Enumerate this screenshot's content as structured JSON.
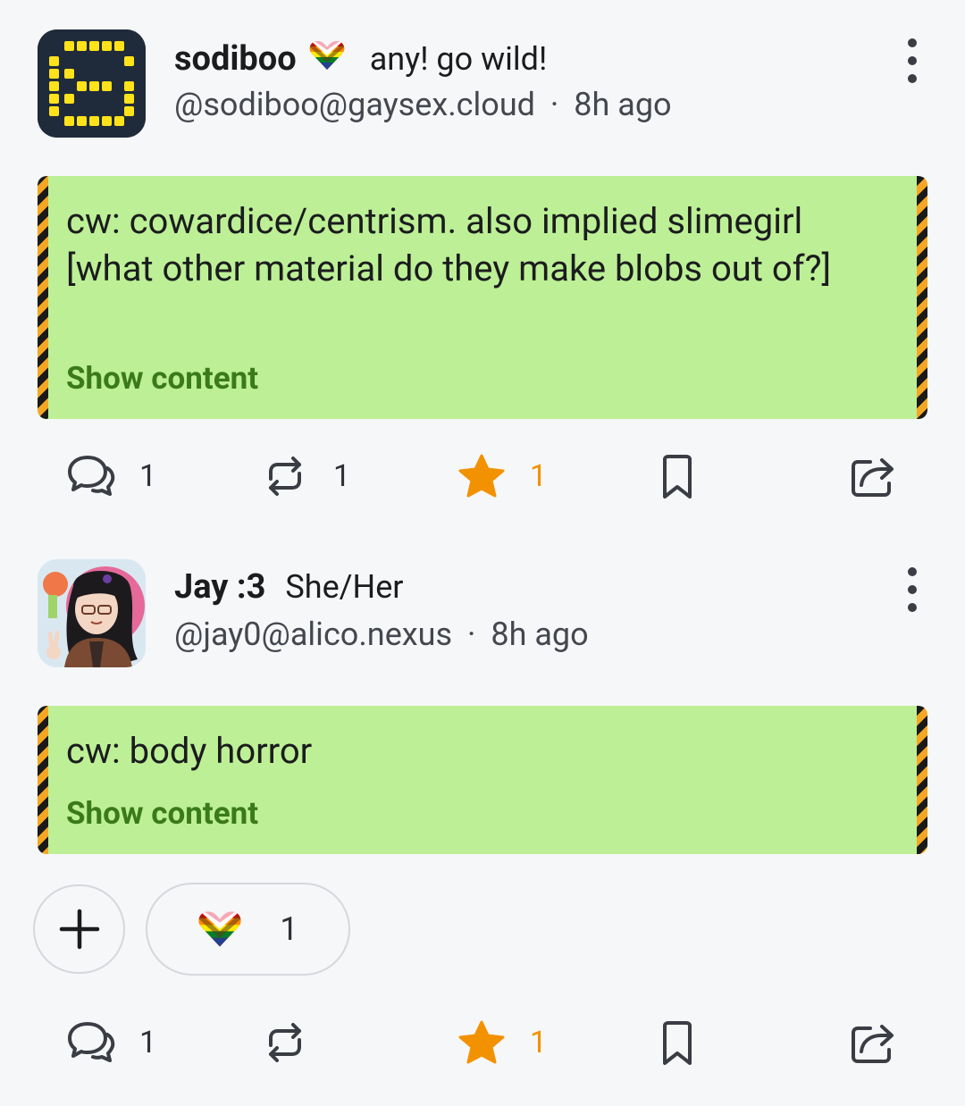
{
  "posts": [
    {
      "display_name": "sodiboo",
      "name_extra": "any! go wild!",
      "handle": "@sodiboo@gaysex.cloud",
      "time": "8h ago",
      "cw_text": "cw: cowardice/centrism. also implied slimegirl [what other material do they make blobs out of?]",
      "show_label": "Show content",
      "actions": {
        "replies": "1",
        "boosts": "1",
        "favourites": "1"
      }
    },
    {
      "display_name": "Jay :3",
      "name_extra": "She/Her",
      "handle": "@jay0@alico.nexus",
      "time": "8h ago",
      "cw_text": "cw: body horror",
      "show_label": "Show content",
      "reaction": {
        "emoji": "progress-pride-heart",
        "count": "1"
      },
      "actions": {
        "replies": "1",
        "favourites": "1"
      }
    }
  ],
  "separator": "·",
  "colors": {
    "cw_bg": "#bdf096",
    "show_content": "#3b7a1b",
    "favourite": "#f39200"
  }
}
